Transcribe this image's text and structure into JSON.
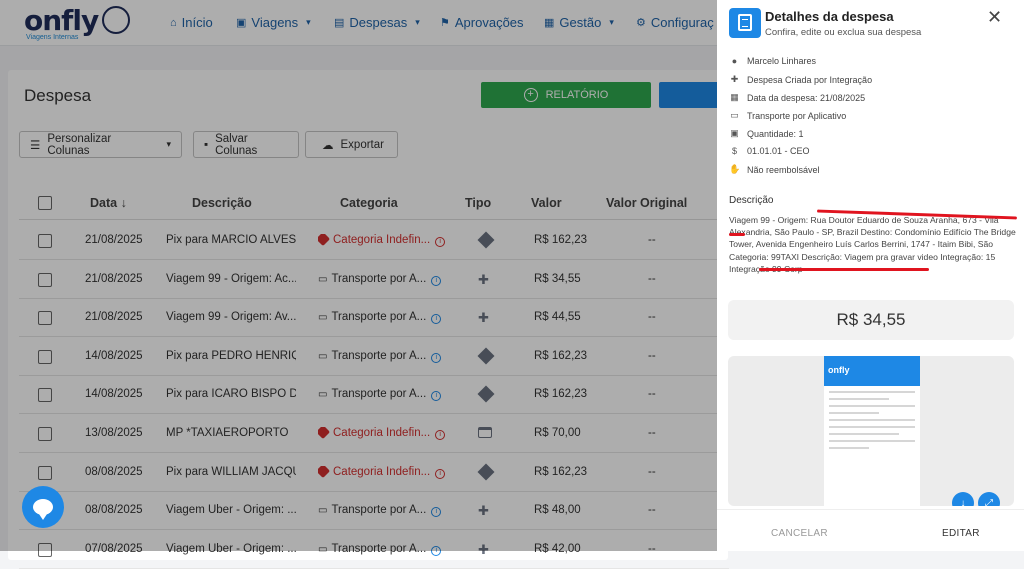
{
  "nav": {
    "logo_text": "onfly",
    "logo_sub": "Viagens Internas",
    "items": [
      {
        "label": "Início",
        "icon": "home-icon"
      },
      {
        "label": "Viagens",
        "icon": "suitcase-icon"
      },
      {
        "label": "Despesas",
        "icon": "receipt-icon"
      },
      {
        "label": "Aprovações",
        "icon": "flag-icon"
      },
      {
        "label": "Gestão",
        "icon": "building-icon"
      },
      {
        "label": "Configuraç",
        "icon": "gear-icon"
      }
    ]
  },
  "page": {
    "title": "Despesa",
    "report_button": "RELATÓRIO",
    "customize_columns": "Personalizar Colunas",
    "save_columns": "Salvar Colunas",
    "export": "Exportar"
  },
  "table": {
    "headers": [
      "Data",
      "Descrição",
      "Categoria",
      "Tipo",
      "Valor",
      "Valor Original"
    ],
    "rows": [
      {
        "date": "21/08/2025",
        "desc": "Pix para MARCIO ALVES P...",
        "category": "Categoria Indefin...",
        "undefined": true,
        "type": "pix",
        "value": "R$ 162,23",
        "original": "--"
      },
      {
        "date": "21/08/2025",
        "desc": "Viagem 99 - Origem: Ac...",
        "category": "Transporte por A...",
        "undefined": false,
        "type": "integration",
        "value": "R$ 34,55",
        "original": "--"
      },
      {
        "date": "21/08/2025",
        "desc": "Viagem 99 - Origem: Av...",
        "category": "Transporte por A...",
        "undefined": false,
        "type": "integration",
        "value": "R$ 44,55",
        "original": "--"
      },
      {
        "date": "14/08/2025",
        "desc": "Pix para PEDRO HENRIQU...",
        "category": "Transporte por A...",
        "undefined": false,
        "type": "pix",
        "value": "R$ 162,23",
        "original": "--"
      },
      {
        "date": "14/08/2025",
        "desc": "Pix para ICARO BISPO DE ...",
        "category": "Transporte por A...",
        "undefined": false,
        "type": "pix",
        "value": "R$ 162,23",
        "original": "--"
      },
      {
        "date": "13/08/2025",
        "desc": "MP *TAXIAEROPORTO",
        "category": "Categoria Indefin...",
        "undefined": true,
        "type": "card",
        "value": "R$ 70,00",
        "original": "--"
      },
      {
        "date": "08/08/2025",
        "desc": "Pix para WILLIAM JACQU...",
        "category": "Categoria Indefin...",
        "undefined": true,
        "type": "pix",
        "value": "R$ 162,23",
        "original": "--"
      },
      {
        "date": "08/08/2025",
        "desc": "Viagem Uber - Origem: ...",
        "category": "Transporte por A...",
        "undefined": false,
        "type": "integration",
        "value": "R$ 48,00",
        "original": "--"
      },
      {
        "date": "07/08/2025",
        "desc": "Viagem Uber - Origem: ...",
        "category": "Transporte por A...",
        "undefined": false,
        "type": "integration",
        "value": "R$ 42,00",
        "original": "--"
      }
    ]
  },
  "drawer": {
    "title": "Detalhes da despesa",
    "subtitle": "Confira, edite ou exclua sua despesa",
    "info": [
      {
        "icon": "user-icon",
        "text": "Marcelo Linhares"
      },
      {
        "icon": "plug-icon",
        "text": "Despesa Criada por Integração"
      },
      {
        "icon": "calendar-icon",
        "text": "Data da despesa: 21/08/2025"
      },
      {
        "icon": "car-icon",
        "text": "Transporte por Aplicativo"
      },
      {
        "icon": "quantity-icon",
        "text": "Quantidade: 1"
      },
      {
        "icon": "dollar-icon",
        "text": "01.01.01 - CEO"
      },
      {
        "icon": "hand-money-icon",
        "text": "Não reembolsável"
      }
    ],
    "description_label": "Descrição",
    "description": "Viagem 99 - Origem: Rua Doutor Eduardo de Souza Aranha, 673 - Vila Alexandria, São Paulo - SP, Brazil Destino: Condomínio Edifício The Bridge Tower, Avenida Engenheiro Luís Carlos Berrini, 1747 - Itaim Bibi, São Categoria: 99TAXI Descrição: Viagem pra gravar video Integração: 15 Integração 99 Corp",
    "amount": "R$ 34,55",
    "receipt_logo": "onfly",
    "cancel": "CANCELAR",
    "edit": "EDITAR"
  }
}
